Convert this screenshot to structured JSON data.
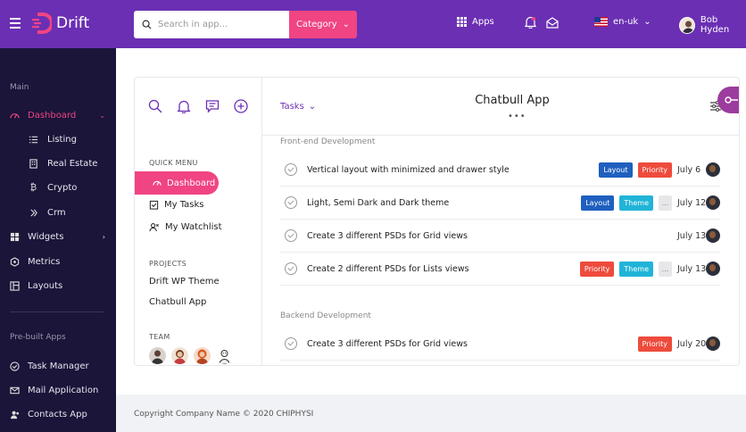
{
  "header": {
    "logo_text": "Drift",
    "search_placeholder": "Search in app...",
    "category_label": "Category",
    "apps_label": "Apps",
    "language": "en-uk",
    "user_name": "Bob Hyden"
  },
  "sidebar": {
    "main_heading": "Main",
    "dashboard": "Dashboard",
    "sub_items": [
      "Listing",
      "Real Estate",
      "Crypto",
      "Crm"
    ],
    "widgets": "Widgets",
    "metrics": "Metrics",
    "layouts": "Layouts",
    "prebuilt_heading": "Pre-built Apps",
    "apps": [
      "Task Manager",
      "Mail Application",
      "Contacts App"
    ]
  },
  "panel": {
    "quick_menu": "QUICK MENU",
    "dashboard": "Dashboard",
    "my_tasks": "My Tasks",
    "my_watchlist": "My Watchlist",
    "projects_heading": "PROJECTS",
    "projects": [
      "Drift WP Theme",
      "Chatbull App"
    ],
    "team_heading": "TEAM"
  },
  "tasks": {
    "dropdown_label": "Tasks",
    "app_title": "Chatbull App",
    "dots": "•••",
    "sections": [
      {
        "title": "Front-end Development",
        "rows": [
          {
            "text": "Vertical layout with minimized and drawer style",
            "tags": [
              "Layout",
              "Priority"
            ],
            "date": "July 6"
          },
          {
            "text": "Light, Semi Dark and Dark theme",
            "tags": [
              "Layout",
              "Theme",
              "..."
            ],
            "date": "July 12"
          },
          {
            "text": "Create 3 different PSDs for Grid views",
            "tags": [],
            "date": "July 13"
          },
          {
            "text": "Create 2 different PSDs for Lists views",
            "tags": [
              "Priority",
              "Theme",
              "..."
            ],
            "date": "July 13"
          }
        ]
      },
      {
        "title": "Backend Development",
        "rows": [
          {
            "text": "Create 3 different PSDs for Grid views",
            "tags": [
              "Priority"
            ],
            "date": "July 20"
          }
        ]
      }
    ]
  },
  "footer": {
    "copyright": "Copyright Company Name © 2020 CHIPHYSI"
  },
  "colors": {
    "brand": "#6b2fb3",
    "accent": "#f04483",
    "sidebar_bg": "#1a1539"
  }
}
